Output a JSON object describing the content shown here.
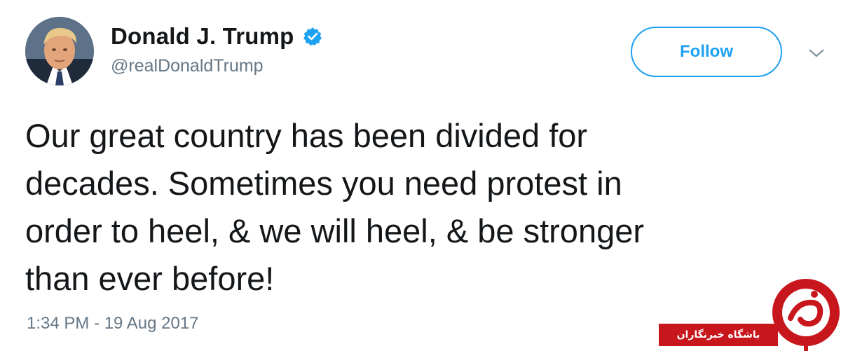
{
  "user": {
    "display_name": "Donald J. Trump",
    "handle": "@realDonaldTrump",
    "verified": true,
    "avatar_icon": "profile-photo"
  },
  "actions": {
    "follow_label": "Follow",
    "more_icon": "chevron-down-icon"
  },
  "tweet": {
    "text": "Our great country has been divided for decades. Sometimes you need protest in order to heel, & we will heel, & be stronger than ever before!",
    "lines": [
      "Our great country has been divided for",
      "decades. Sometimes you need protest in",
      "order to heel, & we will heel, & be stronger",
      "than ever before!"
    ],
    "timestamp": "1:34 PM - 19 Aug 2017"
  },
  "watermark": {
    "text": "باشگاه خبرنگاران",
    "color": "#c8161d"
  },
  "colors": {
    "accent": "#1da1f2",
    "text": "#14171a",
    "muted": "#657786"
  }
}
